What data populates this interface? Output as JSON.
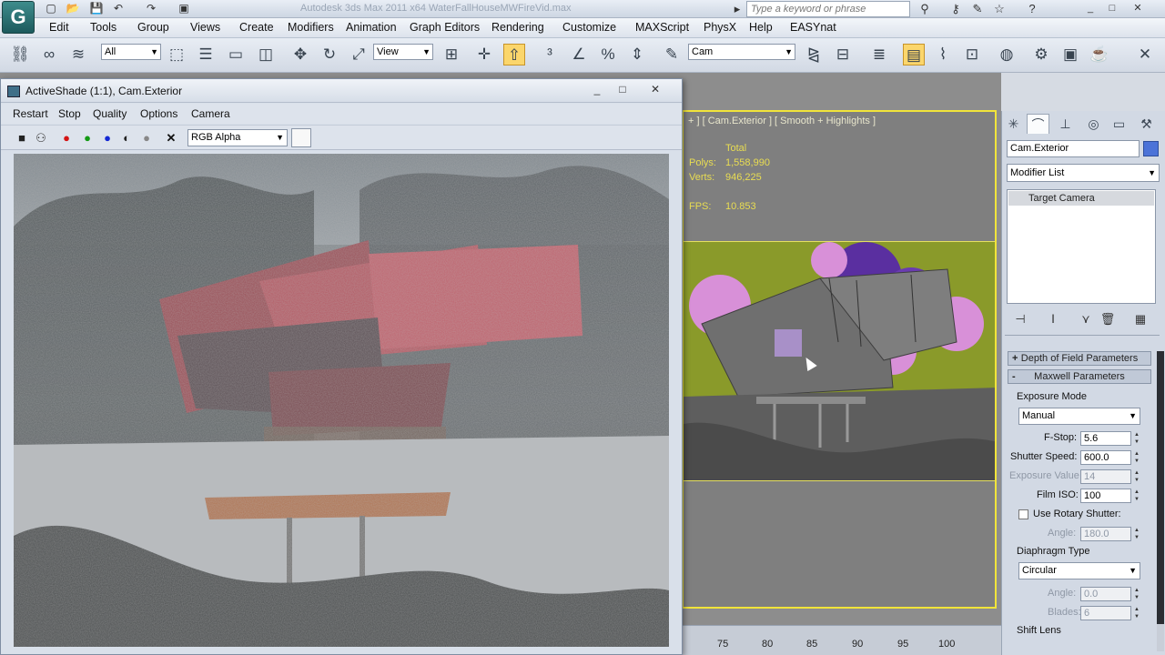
{
  "title_bar": {
    "title": "Autodesk 3ds Max  2011 x64      WaterFallHouseMWFireVid.max",
    "search_placeholder": "Type a keyword or phrase",
    "logo": "G"
  },
  "menu": {
    "items": [
      "Edit",
      "Tools",
      "Group",
      "Views",
      "Create",
      "Modifiers",
      "Animation",
      "Graph Editors",
      "Rendering",
      "Customize",
      "MAXScript",
      "PhysX",
      "Help",
      "EASYnat"
    ]
  },
  "toolbar": {
    "selection_filter": "All",
    "ref_coord": "View",
    "named_selection": "Cam"
  },
  "activeshade": {
    "title": "ActiveShade (1:1), Cam.Exterior",
    "menu": [
      "Restart",
      "Stop",
      "Quality",
      "Options",
      "Camera"
    ],
    "channel": "RGB Alpha"
  },
  "viewport": {
    "label": "+ ] [ Cam.Exterior ] [ Smooth + Highlights ]",
    "total_label": "Total",
    "polys_label": "Polys:",
    "polys_value": "1,558,990",
    "verts_label": "Verts:",
    "verts_value": "946,225",
    "fps_label": "FPS:",
    "fps_value": "10.853"
  },
  "timeline": {
    "ticks": [
      "75",
      "80",
      "85",
      "90",
      "95",
      "100"
    ]
  },
  "command_panel": {
    "object_name": "Cam.Exterior",
    "object_color": "#4c73d8",
    "modifier_list": "Modifier List",
    "stack_item": "Target Camera",
    "rollout_dof": "Depth of Field Parameters",
    "rollout_maxwell": "Maxwell Parameters",
    "exposure_mode_label": "Exposure Mode",
    "exposure_mode": "Manual",
    "fstop_label": "F-Stop:",
    "fstop": "5.6",
    "shutter_label": "Shutter Speed:",
    "shutter": "600.0",
    "exposure_value_label": "Exposure Value",
    "exposure_value": "14",
    "film_iso_label": "Film ISO:",
    "film_iso": "100",
    "rotary_label": "Use Rotary Shutter:",
    "angle_label": "Angle:",
    "rotary_angle": "180.0",
    "diaphragm_label": "Diaphragm Type",
    "diaphragm": "Circular",
    "diaphragm_angle": "0.0",
    "blades_label": "Blades:",
    "blades": "6",
    "shift_lens_label": "Shift Lens"
  }
}
